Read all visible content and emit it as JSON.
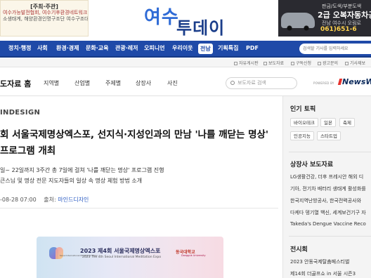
{
  "top_banner": {
    "ad_left": {
      "heading": "[주최·주관]",
      "line1": "여수가능발전협회, 여수기후환경네트워크,",
      "line2": "소생태계, 해양환경인명구조단 여수구조대"
    },
    "logo_line1": "여수",
    "logo_line2": "투데이",
    "ad_right": {
      "line1": "판금/도색/부분도색",
      "line2": "2급 오복자동차공업",
      "line3": "전남 여수시 오림로",
      "line4": "061)651-6"
    }
  },
  "nav": {
    "items": [
      "정치·행정",
      "사회",
      "환경·경제",
      "문화·교육",
      "관광·레저",
      "오피니언",
      "우리이웃",
      "전남",
      "기획특집",
      "PDF"
    ],
    "active_index": 7,
    "search_placeholder": "검색할 기사를 입력하세요"
  },
  "util": {
    "items": [
      "자유게시판",
      "보도자료",
      "구독신청",
      "광고문의",
      "기사제보"
    ]
  },
  "section": {
    "title": "도자료 홈",
    "tabs": [
      "지역별",
      "산업별",
      "주제별",
      "상장사",
      "사진"
    ],
    "search_placeholder": "보도자료 검색",
    "powered_by": "POWERED BY",
    "newswire": "NewsWir"
  },
  "article": {
    "brand": "INDESIGN",
    "headline": "회 서울국제명상엑스포, 선지식·지성인과의 만남 '나를 깨닫는 명상' 프로그램 개최",
    "sub_line1": "일~ 22일까지 3주간 총 7일에 걸쳐 '나를 깨닫는 명상' 프로그램 진행",
    "sub_line2": "큰스님 및 명상 전문 지도자들의 일상 속 명상 체험 방법 소개",
    "date": "-08-28 07:00",
    "source_label": "출처:",
    "source_name": "마인드디자인",
    "poster": {
      "title": "2023 제4회 서울국제명상엑스포",
      "subtitle": "2023 The 4th Seoul International Meditation Expo",
      "mini": "Seoul International Meditation Expo",
      "org": "동국대학교",
      "org_en": "Dongguk University"
    }
  },
  "sidebar": {
    "topics_heading": "인기 토픽",
    "topics": [
      "바이오테크",
      "일본",
      "축제",
      "인공지능",
      "스타트업"
    ],
    "press_heading": "상장사 보도자료",
    "press": [
      "LG생활건강, 더후 프레시안 해외 디",
      "기아, 전기차 배터리 생태계 활성화를",
      "한국지역난방공사, 한국전력공사와",
      "다케다 뎅기열 백신, 세계보건기구 자",
      "Takeda's Dengue Vaccine Reco"
    ],
    "exhibit_heading": "전시회",
    "exhibits": [
      "2023 안동국제탈춤페스티벌",
      "제14회 더골프쇼 in 서울 시즌3"
    ]
  }
}
